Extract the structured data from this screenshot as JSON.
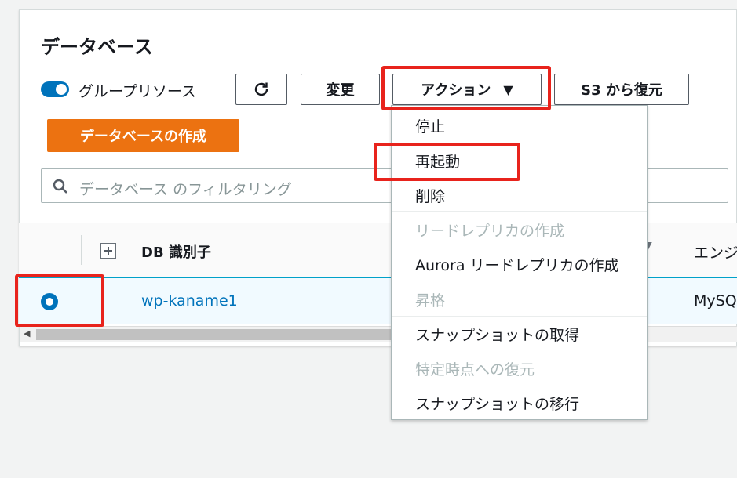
{
  "page": {
    "title": "データベース"
  },
  "toolbar": {
    "group_resources_label": "グループリソース",
    "group_resources_enabled": true,
    "modify_label": "変更",
    "actions_label": "アクション",
    "actions_caret": "▼",
    "restore_s3_label": "S3 から復元",
    "create_db_label": "データベースの作成"
  },
  "search": {
    "placeholder": "データベース のフィルタリング"
  },
  "table": {
    "columns": {
      "db_identifier": "DB 識別子",
      "engine": "エンジ"
    },
    "rows": [
      {
        "db_identifier": "wp-kaname1",
        "engine": "MySQ",
        "selected": true
      }
    ]
  },
  "actions_menu": {
    "items": [
      {
        "label": "停止",
        "disabled": false
      },
      {
        "label": "再起動",
        "disabled": false
      },
      {
        "label": "削除",
        "disabled": false
      },
      {
        "label": "リードレプリカの作成",
        "disabled": true
      },
      {
        "label": "Aurora リードレプリカの作成",
        "disabled": false
      },
      {
        "label": "昇格",
        "disabled": true
      },
      {
        "label": "スナップショットの取得",
        "disabled": false
      },
      {
        "label": "特定時点への復元",
        "disabled": true
      },
      {
        "label": "スナップショットの移行",
        "disabled": false
      }
    ]
  },
  "colors": {
    "accent": "#0073bb",
    "create_button": "#ec7211",
    "highlight": "#e8231c"
  }
}
